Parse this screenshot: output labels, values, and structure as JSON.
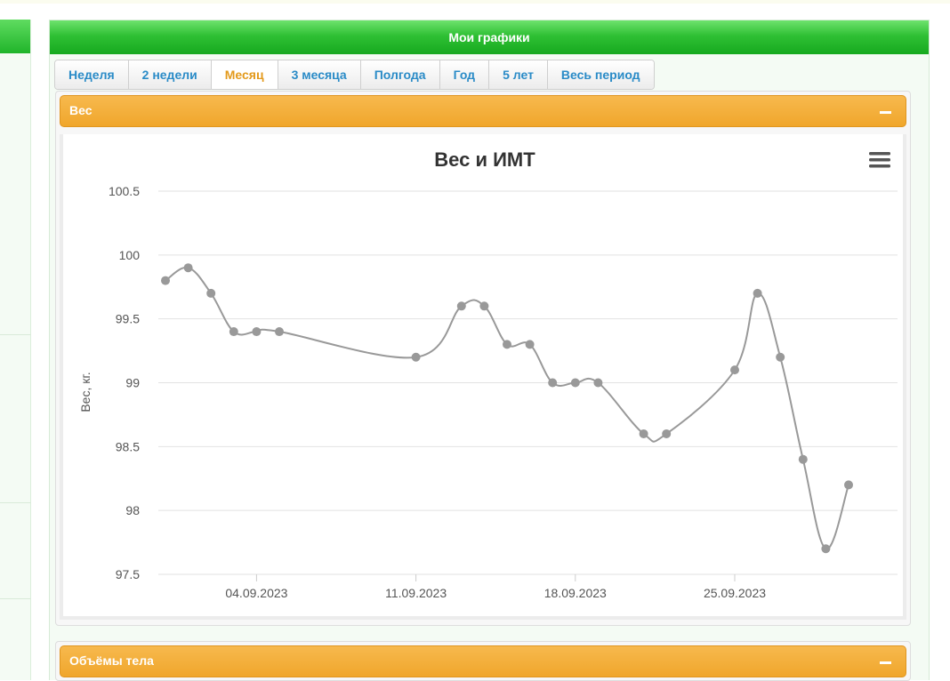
{
  "header": {
    "title": "Мои графики"
  },
  "tabs": [
    {
      "label": "Неделя",
      "active": false
    },
    {
      "label": "2 недели",
      "active": false
    },
    {
      "label": "Месяц",
      "active": true
    },
    {
      "label": "3 месяца",
      "active": false
    },
    {
      "label": "Полгода",
      "active": false
    },
    {
      "label": "Год",
      "active": false
    },
    {
      "label": "5 лет",
      "active": false
    },
    {
      "label": "Весь период",
      "active": false
    }
  ],
  "sections": {
    "weight": {
      "title": "Вес"
    },
    "volumes": {
      "title": "Объёмы тела"
    }
  },
  "icons": {
    "menu": "hamburger-menu-icon",
    "collapse": "minus-icon"
  },
  "colors": {
    "header_green": "#1fb02a",
    "tab_active": "#e39a1c",
    "tab_text": "#2a8bc7",
    "section_orange": "#f3ad38",
    "series_line": "#999999"
  },
  "chart_data": {
    "type": "line",
    "title": "Вес и ИМТ",
    "ylabel": "Вес, кг.",
    "xlabel": "",
    "ylim": [
      97.5,
      100.5
    ],
    "yticks": [
      97.5,
      98,
      98.5,
      99,
      99.5,
      100,
      100.5
    ],
    "ytick_labels": [
      "97.5",
      "98",
      "98.5",
      "99",
      "99.5",
      "100",
      "100.5"
    ],
    "xlim": [
      "2023-08-31",
      "2023-09-30"
    ],
    "xticks": [
      "2023-09-04",
      "2023-09-11",
      "2023-09-18",
      "2023-09-25"
    ],
    "xtick_labels": [
      "04.09.2023",
      "11.09.2023",
      "18.09.2023",
      "25.09.2023"
    ],
    "grid": true,
    "legend": false,
    "series": [
      {
        "points": [
          {
            "x": "2023-08-31",
            "y": 99.8
          },
          {
            "x": "2023-09-01",
            "y": 99.9
          },
          {
            "x": "2023-09-02",
            "y": 99.7
          },
          {
            "x": "2023-09-03",
            "y": 99.4
          },
          {
            "x": "2023-09-04",
            "y": 99.4
          },
          {
            "x": "2023-09-05",
            "y": 99.4
          },
          {
            "x": "2023-09-11",
            "y": 99.2
          },
          {
            "x": "2023-09-13",
            "y": 99.6
          },
          {
            "x": "2023-09-14",
            "y": 99.6
          },
          {
            "x": "2023-09-15",
            "y": 99.3
          },
          {
            "x": "2023-09-16",
            "y": 99.3
          },
          {
            "x": "2023-09-17",
            "y": 99.0
          },
          {
            "x": "2023-09-18",
            "y": 99.0
          },
          {
            "x": "2023-09-19",
            "y": 99.0
          },
          {
            "x": "2023-09-21",
            "y": 98.6
          },
          {
            "x": "2023-09-22",
            "y": 98.6
          },
          {
            "x": "2023-09-25",
            "y": 99.1
          },
          {
            "x": "2023-09-26",
            "y": 99.7
          },
          {
            "x": "2023-09-27",
            "y": 99.2
          },
          {
            "x": "2023-09-28",
            "y": 98.4
          },
          {
            "x": "2023-09-29",
            "y": 97.7
          },
          {
            "x": "2023-09-30",
            "y": 98.2
          }
        ]
      }
    ]
  }
}
